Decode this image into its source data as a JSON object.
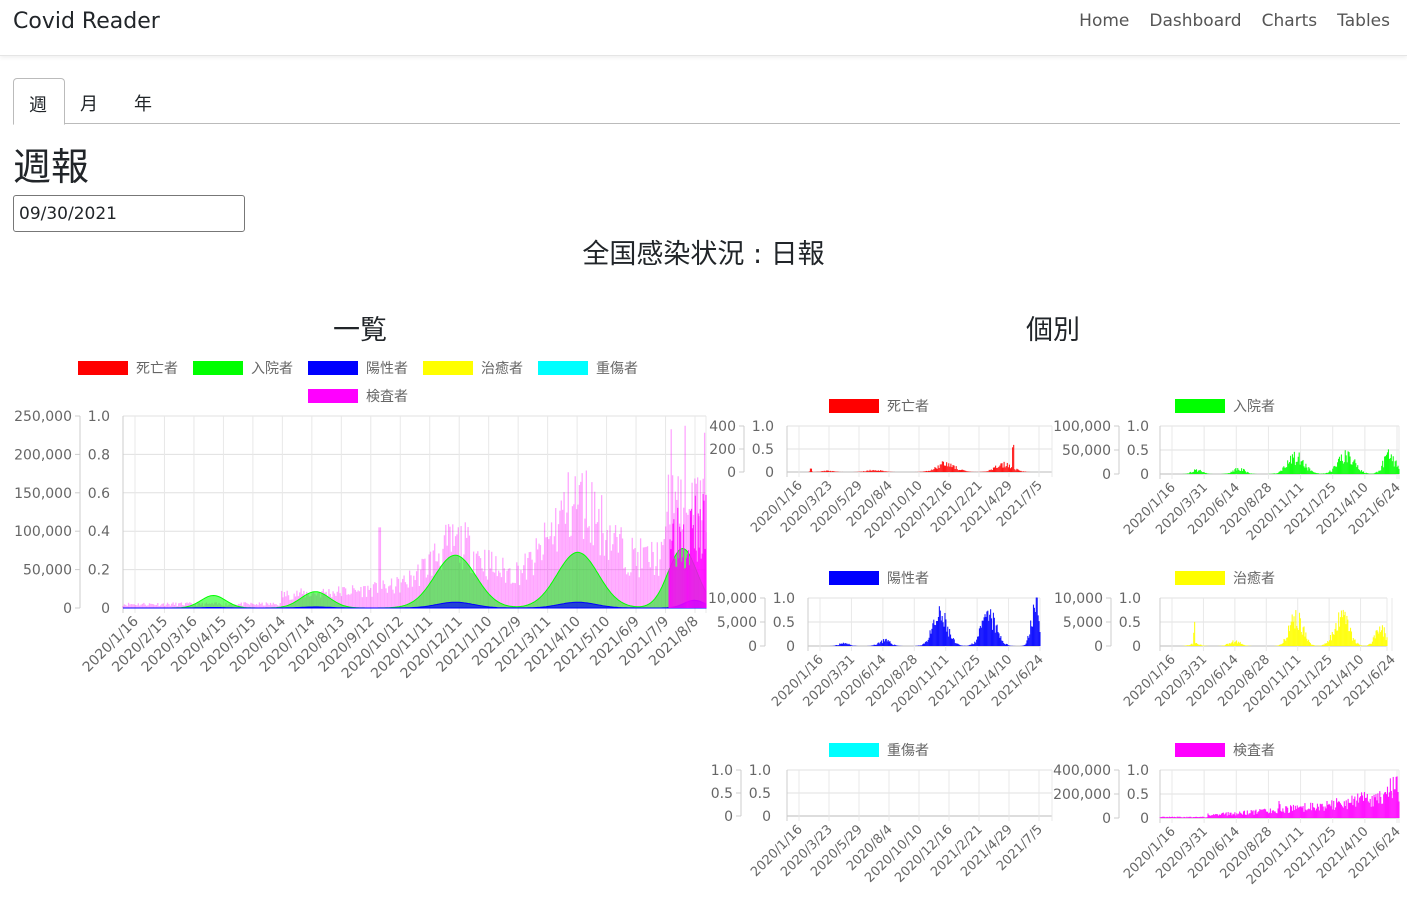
{
  "brand": "Covid Reader",
  "nav": [
    "Home",
    "Dashboard",
    "Charts",
    "Tables"
  ],
  "tabs": [
    "週",
    "月",
    "年"
  ],
  "heading": "週報",
  "date_value": "09/30/2021",
  "main_title": "全国感染状況 : 日報",
  "left_title": "一覧",
  "right_title": "個別",
  "legend": [
    {
      "name": "死亡者",
      "color": "#ff0000"
    },
    {
      "name": "入院者",
      "color": "#00ff00"
    },
    {
      "name": "陽性者",
      "color": "#0000ff"
    },
    {
      "name": "治癒者",
      "color": "#ffff00"
    },
    {
      "name": "重傷者",
      "color": "#00ffff"
    },
    {
      "name": "検査者",
      "color": "#ff00ff"
    }
  ],
  "chart_data": [
    {
      "type": "area",
      "id": "overview",
      "y_left_ticks": [
        "250,000",
        "200,000",
        "150,000",
        "100,000",
        "50,000",
        "0"
      ],
      "y_right_ticks": [
        "1.0",
        "0.8",
        "0.6",
        "0.4",
        "0.2",
        "0"
      ],
      "x_ticks": [
        "2020/1/16",
        "2020/2/15",
        "2020/3/16",
        "2020/4/15",
        "2020/5/15",
        "2020/6/14",
        "2020/7/14",
        "2020/8/13",
        "2020/9/12",
        "2020/10/12",
        "2020/11/11",
        "2020/12/11",
        "2021/1/10",
        "2021/2/9",
        "2021/3/11",
        "2021/4/10",
        "2021/5/10",
        "2021/6/9",
        "2021/7/9",
        "2021/8/8"
      ]
    },
    {
      "type": "area",
      "id": "deaths",
      "series": "死亡者",
      "color": "#ff0000",
      "y_left_ticks": [
        "400",
        "200",
        "0"
      ],
      "y_right_ticks": [
        "1.0",
        "0.5",
        "0"
      ],
      "x_ticks": [
        "2020/1/16",
        "2020/3/23",
        "2020/5/29",
        "2020/8/4",
        "2020/10/10",
        "2020/12/16",
        "2021/2/21",
        "2021/4/29",
        "2021/7/5"
      ]
    },
    {
      "type": "area",
      "id": "hospital",
      "series": "入院者",
      "color": "#00ff00",
      "y_left_ticks": [
        "100,000",
        "50,000",
        "0"
      ],
      "y_right_ticks": [
        "1.0",
        "0.5",
        "0"
      ],
      "x_ticks": [
        "2020/1/16",
        "2020/3/31",
        "2020/6/14",
        "2020/8/28",
        "2020/11/11",
        "2021/1/25",
        "2021/4/10",
        "2021/6/24"
      ]
    },
    {
      "type": "area",
      "id": "positive",
      "series": "陽性者",
      "color": "#0000ff",
      "y_left_ticks": [
        "10,000",
        "5,000",
        "0"
      ],
      "y_right_ticks": [
        "1.0",
        "0.5",
        "0"
      ],
      "x_ticks": [
        "2020/1/16",
        "2020/3/31",
        "2020/6/14",
        "2020/8/28",
        "2020/11/11",
        "2021/1/25",
        "2021/4/10",
        "2021/6/24"
      ]
    },
    {
      "type": "area",
      "id": "recovered",
      "series": "治癒者",
      "color": "#ffff00",
      "y_left_ticks": [
        "10,000",
        "5,000",
        "0"
      ],
      "y_right_ticks": [
        "1.0",
        "0.5",
        "0"
      ],
      "x_ticks": [
        "2020/1/16",
        "2020/3/31",
        "2020/6/14",
        "2020/8/28",
        "2020/11/11",
        "2021/1/25",
        "2021/4/10",
        "2021/6/24"
      ]
    },
    {
      "type": "area",
      "id": "severe",
      "series": "重傷者",
      "color": "#00ffff",
      "y_left_ticks": [
        "1.0",
        "0.5",
        "0"
      ],
      "y_right_ticks": [
        "1.0",
        "0.5",
        "0"
      ],
      "x_ticks": [
        "2020/1/16",
        "2020/3/23",
        "2020/5/29",
        "2020/8/4",
        "2020/10/10",
        "2020/12/16",
        "2021/2/21",
        "2021/4/29",
        "2021/7/5"
      ]
    },
    {
      "type": "area",
      "id": "tested",
      "series": "検査者",
      "color": "#ff00ff",
      "y_left_ticks": [
        "400,000",
        "200,000",
        "0"
      ],
      "y_right_ticks": [
        "1.0",
        "0.5",
        "0"
      ],
      "x_ticks": [
        "2020/1/16",
        "2020/3/31",
        "2020/6/14",
        "2020/8/28",
        "2020/11/11",
        "2021/1/25",
        "2021/4/10",
        "2021/6/24"
      ]
    }
  ]
}
